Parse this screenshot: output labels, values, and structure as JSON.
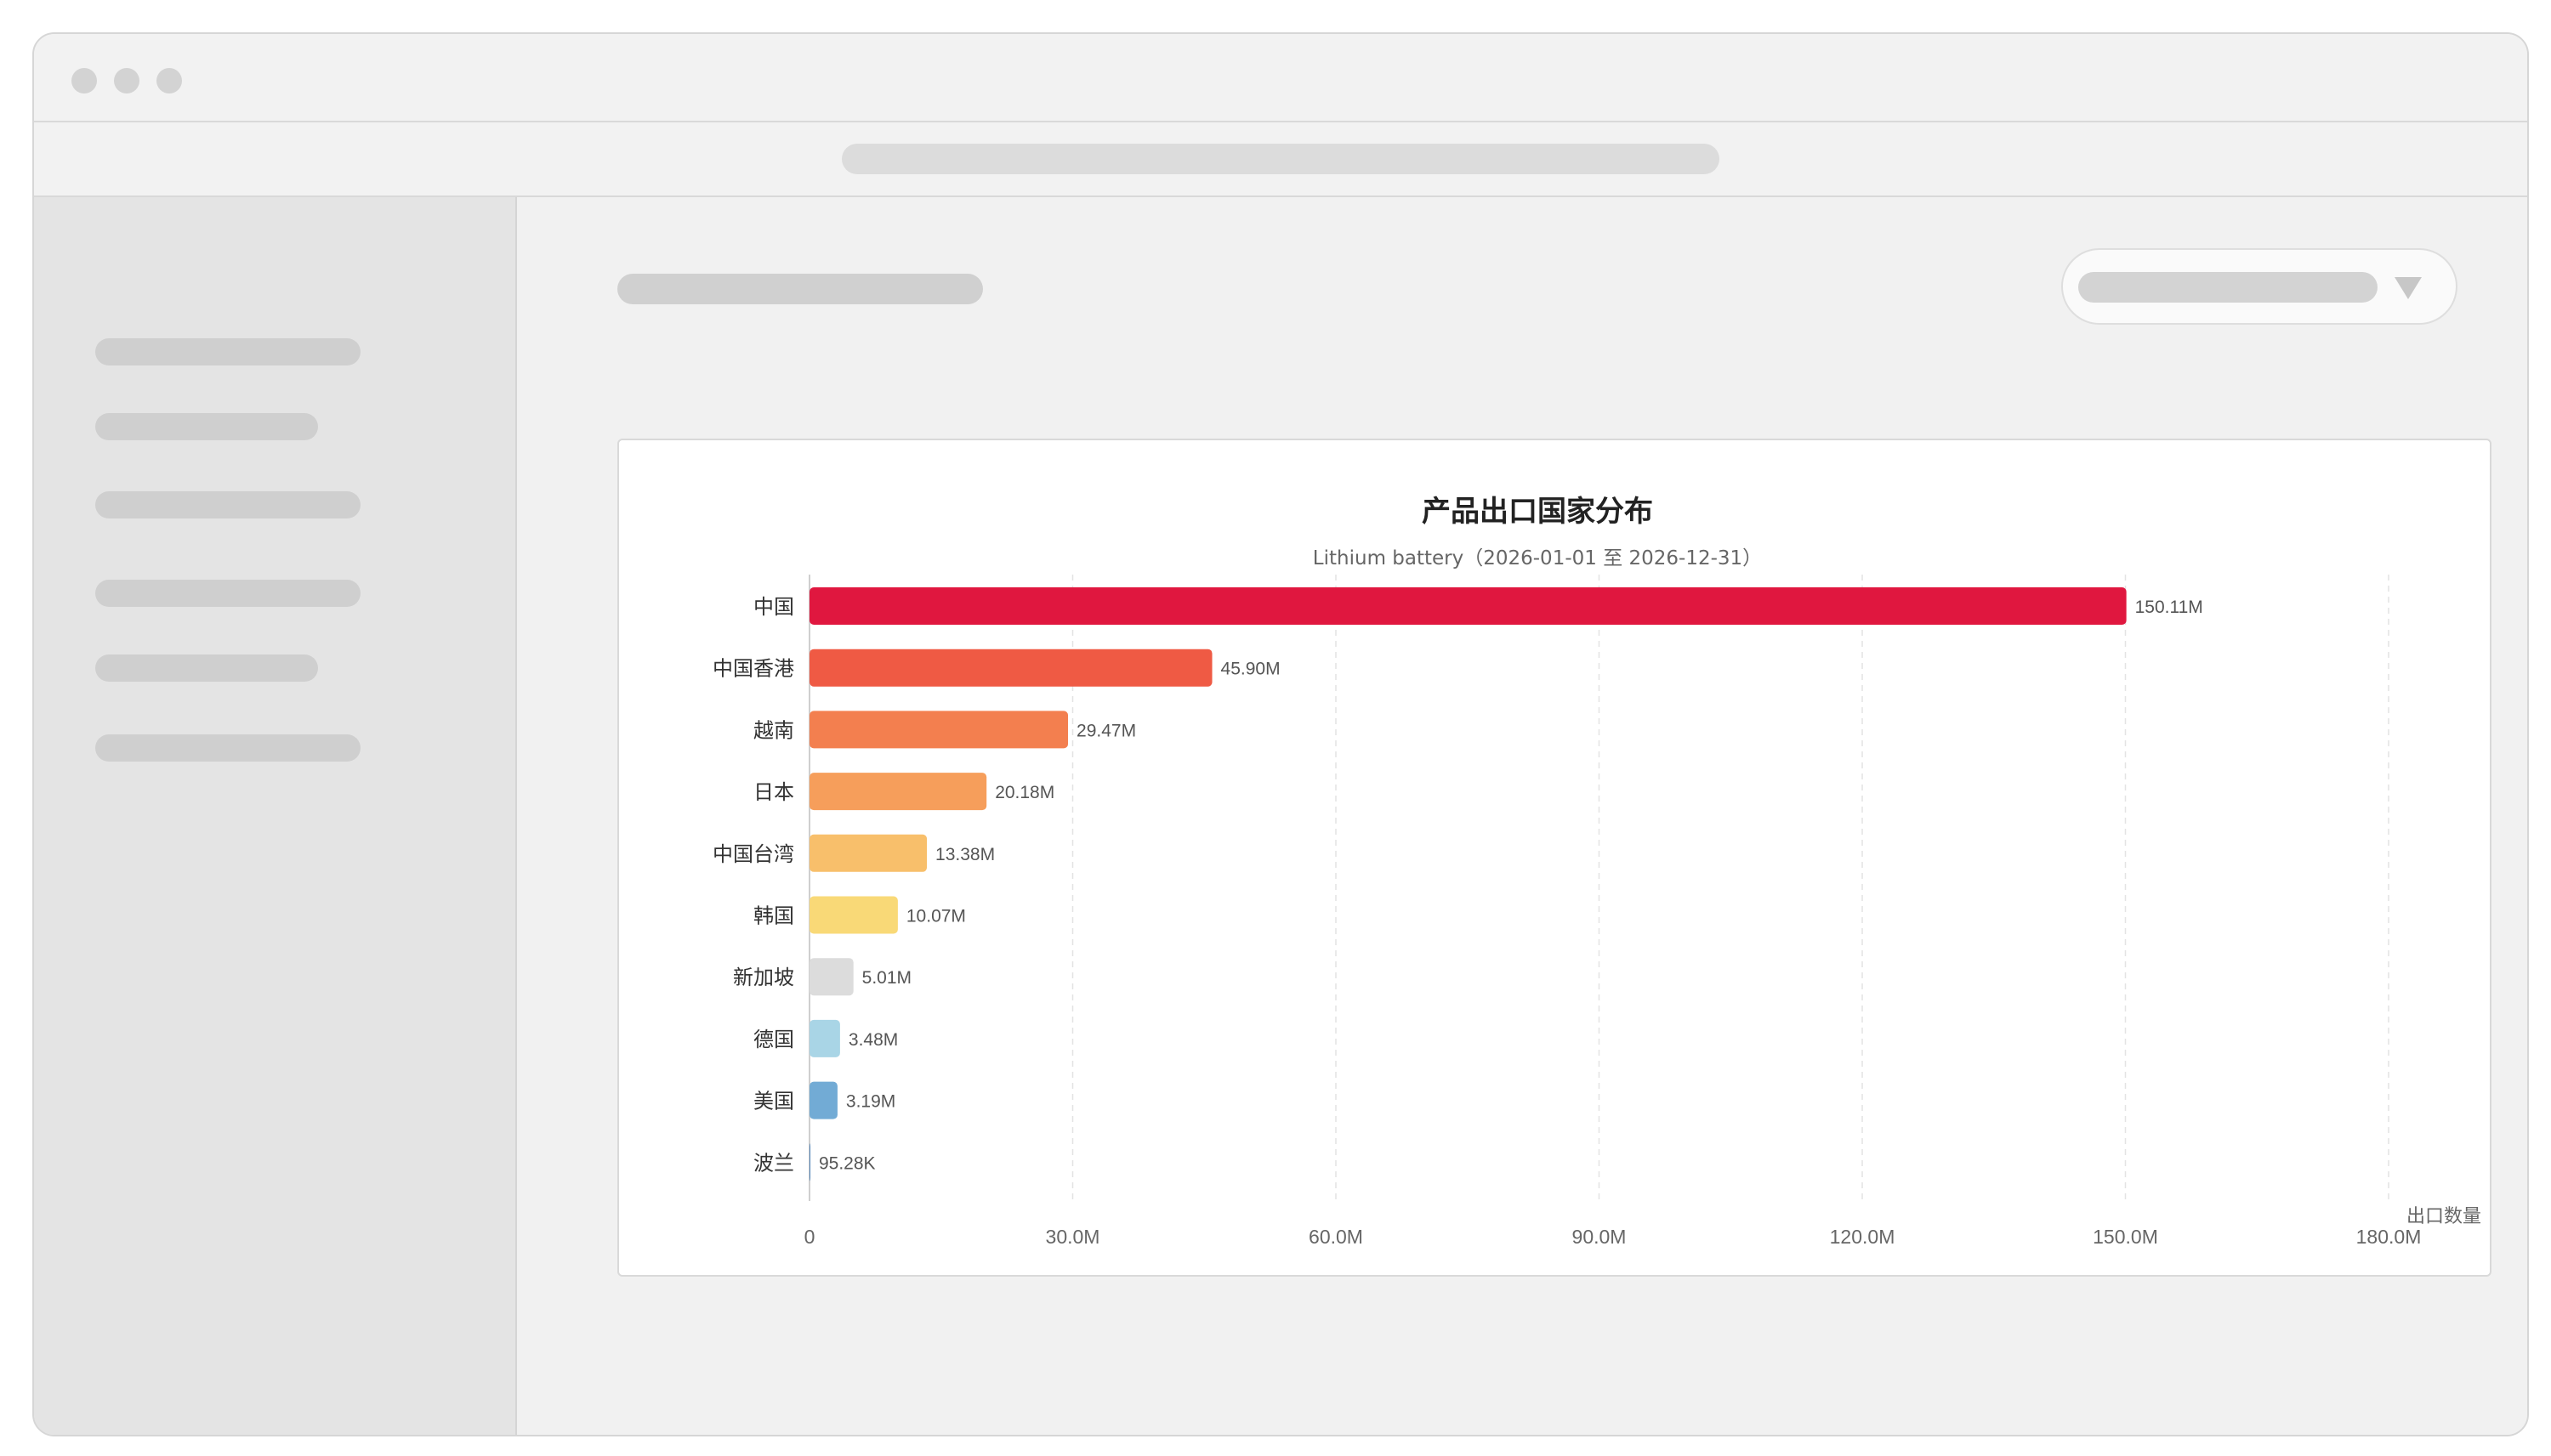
{
  "chart_data": {
    "type": "bar",
    "orientation": "horizontal",
    "title": "产品出口国家分布",
    "subtitle": "Lithium battery（2026-01-01 至 2026-12-31）",
    "xlabel": "出口数量",
    "ylabel": "",
    "xlim": [
      0,
      180000000
    ],
    "x_ticks": [
      "0",
      "30.0M",
      "60.0M",
      "90.0M",
      "120.0M",
      "150.0M",
      "180.0M"
    ],
    "grid": true,
    "categories": [
      "中国",
      "中国香港",
      "越南",
      "日本",
      "中国台湾",
      "韩国",
      "新加坡",
      "德国",
      "美国",
      "波兰"
    ],
    "values": [
      150110000,
      45900000,
      29470000,
      20180000,
      13380000,
      10070000,
      5010000,
      3480000,
      3190000,
      95280
    ],
    "value_labels": [
      "150.11M",
      "45.90M",
      "29.47M",
      "20.18M",
      "13.38M",
      "10.07M",
      "5.01M",
      "3.48M",
      "3.19M",
      "95.28K"
    ],
    "colors": [
      "#e0173f",
      "#ef5a44",
      "#f37f4f",
      "#f69e5b",
      "#f8bf6b",
      "#f9d977",
      "#dcdcdc",
      "#a9d5e6",
      "#72abd5",
      "#4a7fb5"
    ]
  }
}
